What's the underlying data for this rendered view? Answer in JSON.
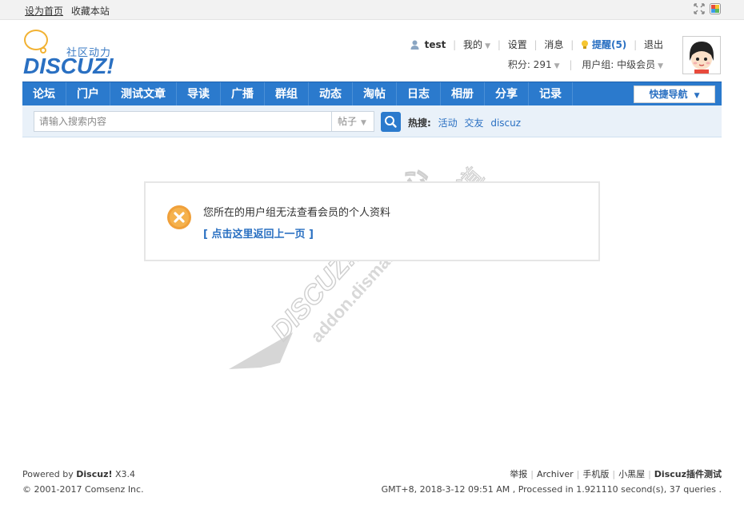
{
  "topbar": {
    "set_homepage": "设为首页",
    "bookmark": "收藏本站"
  },
  "logo": {
    "slogan": "社区动力",
    "wordmark": "DISCUZ!"
  },
  "user": {
    "name": "test",
    "my_menu": "我的",
    "settings": "设置",
    "messages": "消息",
    "remind": "提醒(5)",
    "logout": "退出",
    "points": "积分: 291",
    "usergroup": "用户组: 中级会员"
  },
  "nav": {
    "items": [
      "论坛",
      "门户",
      "测试文章",
      "导读",
      "广播",
      "群组",
      "动态",
      "淘帖",
      "日志",
      "相册",
      "分享",
      "记录"
    ],
    "quick_nav": "快捷导航"
  },
  "search": {
    "placeholder": "请输入搜索内容",
    "type": "帖子",
    "hot_label": "热搜:",
    "hot_terms": [
      "活动",
      "交友",
      "discuz"
    ]
  },
  "message": {
    "text": "您所在的用户组无法查看会员的个人资料",
    "back_link": "[ 点击这里返回上一页 ]"
  },
  "watermark": {
    "brand": "DISCUZ!应用中心",
    "url": "addon.dismall.com",
    "right": "贰道"
  },
  "footer": {
    "powered_prefix": "Powered by ",
    "powered_brand": "Discuz!",
    "version": " X3.4",
    "copyright": "© 2001-2017 Comsenz Inc.",
    "links": [
      "举报",
      "Archiver",
      "手机版",
      "小黑屋"
    ],
    "site": "Discuz插件测试",
    "stats": "GMT+8, 2018-3-12 09:51 AM , Processed in 1.921110 second(s), 37 queries ."
  },
  "colors": {
    "nav_blue": "#2b7acd",
    "link_blue": "#2a70c2",
    "search_bg": "#e9f1f9",
    "error_orange": "#f5a623"
  }
}
